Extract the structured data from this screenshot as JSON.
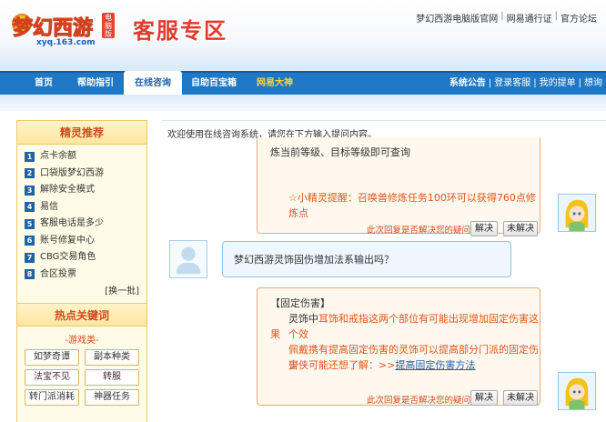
{
  "header": {
    "logo_badge": "电脑版",
    "logo_url": "xyq.163.com",
    "title": "客服专区",
    "top_links": [
      "梦幻西游电脑版官网",
      "网易通行证",
      "官方论坛"
    ]
  },
  "nav": {
    "items": [
      "首页",
      "帮助指引",
      "在线咨询",
      "自助百宝箱",
      "网易大神"
    ],
    "right_items": [
      "系统公告",
      "登录客服",
      "我的提单",
      "想询"
    ]
  },
  "sidebar": {
    "title": "精灵推荐",
    "faq": [
      {
        "num": "1",
        "label": "点卡余额"
      },
      {
        "num": "2",
        "label": "口袋版梦幻西游"
      },
      {
        "num": "3",
        "label": "解除安全模式"
      },
      {
        "num": "4",
        "label": "易信"
      },
      {
        "num": "5",
        "label": "客服电话是多少"
      },
      {
        "num": "6",
        "label": "账号修复中心"
      },
      {
        "num": "7",
        "label": "CBG交易角色"
      },
      {
        "num": "8",
        "label": "合区投票"
      }
    ],
    "change_label": "[换一批]",
    "hot_title": "热点关键词",
    "keyword_category": "-游戏类-",
    "keywords": [
      "如梦奇谭",
      "副本种类",
      "法宝不见",
      "转服",
      "转门派消耗",
      "神器任务"
    ]
  },
  "chat": {
    "welcome": "欢迎使用在线咨询系统，请您在下方输入提问内容。",
    "msg1": {
      "line1": "炼当前等级、目标等级即可查询",
      "tip": "☆小精灵提醒：召唤兽修炼任务100环可以获得760点修炼点",
      "ask": "此次回复是否解决您的疑问:",
      "solved": "解决",
      "unsolved": "未解决"
    },
    "user_question": "梦幻西游灵饰固伤增加法系输出吗？",
    "msg2": {
      "heading": "【固定伤害】",
      "line1a": "灵饰中",
      "line1b": "耳饰和戒指这两个部位有可能出现增加固定伤害这个效",
      "line2": "果",
      "line3": "佩戴携有提高固定伤害的灵饰可以提高部分门派的固定伤害",
      "line4a": "少侠可能还想了解：>>",
      "line4b": "提高固定伤害方法",
      "ask": "此次回复是否解决您的疑问:",
      "solved": "解决",
      "unsolved": "未解决"
    }
  }
}
